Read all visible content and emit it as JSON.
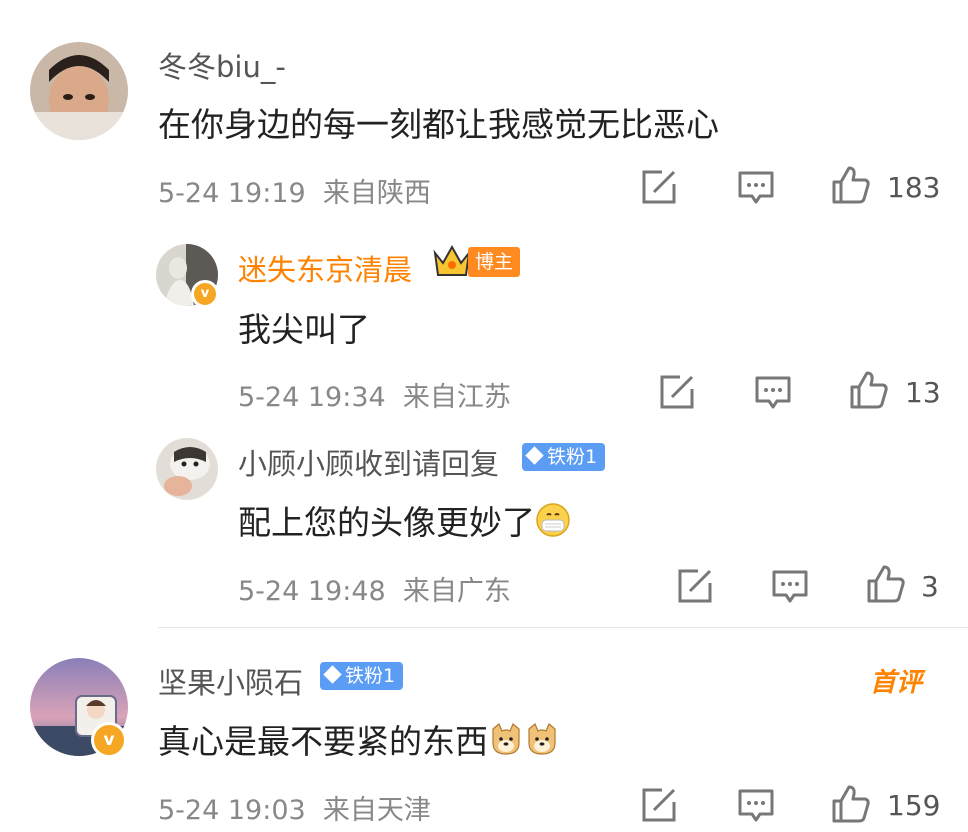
{
  "comments": [
    {
      "username": "冬冬biu_-",
      "text": "在你身边的每一刻都让我感觉无比恶心",
      "time": "5-24 19:19",
      "location": "来自陕西",
      "likes": "183"
    },
    {
      "username": "迷失东京清晨",
      "badge": "博主",
      "text": "我尖叫了",
      "time": "5-24 19:34",
      "location": "来自江苏",
      "likes": "13"
    },
    {
      "username": "小顾小顾收到请回复",
      "badge": "铁粉1",
      "text": "配上您的头像更妙了",
      "emoji": "mask-face",
      "time": "5-24 19:48",
      "location": "来自广东",
      "likes": "3"
    },
    {
      "username": "坚果小陨石",
      "badge": "铁粉1",
      "first_badge": "首评",
      "text": "真心是最不要紧的东西",
      "emoji": "doge",
      "time": "5-24 19:03",
      "location": "来自天津",
      "likes": "159"
    }
  ],
  "colors": {
    "accent": "#ff8200",
    "fan_badge": "#5b9cf5",
    "meta": "#888888"
  }
}
